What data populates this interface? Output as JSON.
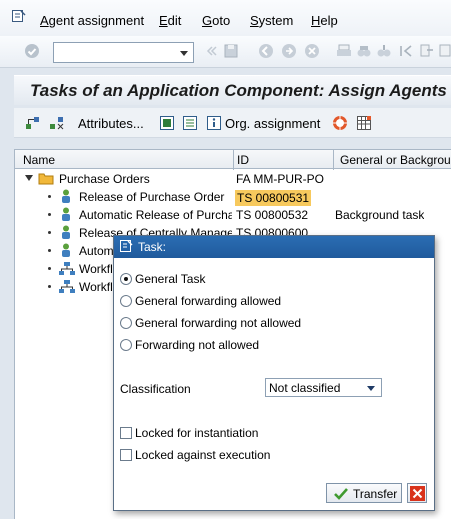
{
  "menubar": {
    "items": [
      {
        "underline": "A",
        "rest": "gent assignment"
      },
      {
        "underline": "E",
        "rest": "dit"
      },
      {
        "underline": "G",
        "rest": "oto"
      },
      {
        "underline": "S",
        "rest": "ystem"
      },
      {
        "underline": "H",
        "rest": "elp"
      }
    ]
  },
  "toolbar": {
    "command_value": ""
  },
  "title": "Tasks of an Application Component: Assign Agents",
  "app_toolbar": {
    "attributes_label": "Attributes...",
    "org_assignment_label": "Org. assignment"
  },
  "tree": {
    "columns": [
      "Name",
      "ID",
      "General or Background"
    ],
    "root": {
      "name": "Purchase Orders",
      "id": "FA MM-PUR-PO"
    },
    "rows": [
      {
        "name": "Release of Purchase Order",
        "id": "TS 00800531",
        "type": ""
      },
      {
        "name": "Automatic Release of Purchase Order",
        "id": "TS 00800532",
        "type": "Background task"
      },
      {
        "name": "Release of Centrally Managed",
        "id": "TS 00800600",
        "type": ""
      },
      {
        "name": "Automatic",
        "id": "",
        "type": ""
      },
      {
        "name": "Workflow",
        "id": "",
        "type": ""
      },
      {
        "name": "Workflow",
        "id": "",
        "type": ""
      }
    ]
  },
  "dialog": {
    "title": "Task:",
    "options": [
      {
        "label": "General Task",
        "selected": true
      },
      {
        "label": "General forwarding allowed",
        "selected": false
      },
      {
        "label": "General forwarding not allowed",
        "selected": false
      },
      {
        "label": "Forwarding not allowed",
        "selected": false
      }
    ],
    "classification_label": "Classification",
    "classification_value": "Not classified",
    "locked_instantiation_label": "Locked for instantiation",
    "locked_execution_label": "Locked against execution",
    "transfer_label": "Transfer"
  },
  "colors": {
    "highlight": "#f7c95d",
    "dialog_title_bg": "#2b6db3"
  }
}
